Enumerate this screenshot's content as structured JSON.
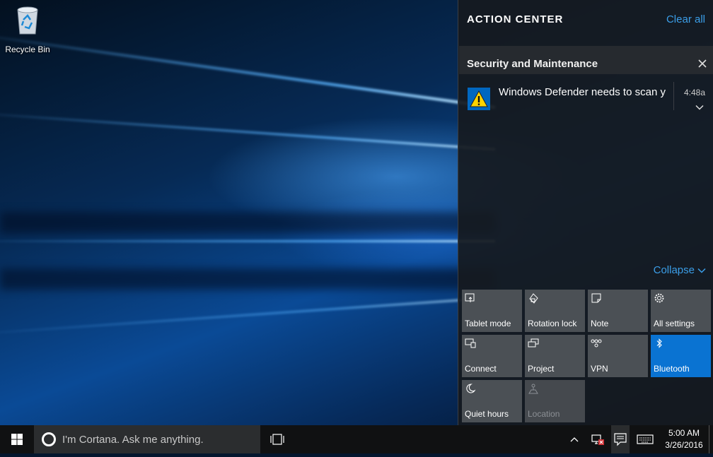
{
  "desktop": {
    "icons": [
      {
        "label": "Recycle Bin",
        "icon": "recycle-bin-icon"
      }
    ]
  },
  "action_center": {
    "title": "ACTION CENTER",
    "clear_all": "Clear all",
    "groups": [
      {
        "name": "Security and Maintenance",
        "notifications": [
          {
            "icon": "warning-icon",
            "text": "Windows Defender needs to scan your",
            "time": "4:48a"
          }
        ]
      }
    ],
    "collapse_label": "Collapse",
    "quick_actions": [
      {
        "label": "Tablet mode",
        "icon": "tablet-mode-icon",
        "state": "off"
      },
      {
        "label": "Rotation lock",
        "icon": "rotation-lock-icon",
        "state": "off"
      },
      {
        "label": "Note",
        "icon": "note-icon",
        "state": "off"
      },
      {
        "label": "All settings",
        "icon": "gear-icon",
        "state": "off"
      },
      {
        "label": "Connect",
        "icon": "connect-icon",
        "state": "off"
      },
      {
        "label": "Project",
        "icon": "project-icon",
        "state": "off"
      },
      {
        "label": "VPN",
        "icon": "vpn-icon",
        "state": "off"
      },
      {
        "label": "Bluetooth",
        "icon": "bluetooth-icon",
        "state": "on"
      },
      {
        "label": "Quiet hours",
        "icon": "moon-icon",
        "state": "off"
      },
      {
        "label": "Location",
        "icon": "location-icon",
        "state": "disabled"
      }
    ]
  },
  "taskbar": {
    "search_placeholder": "I'm Cortana. Ask me anything.",
    "clock_time": "5:00 AM",
    "clock_date": "3/26/2016"
  },
  "colors": {
    "accent": "#0a73d2",
    "link": "#3b9ee8",
    "tile": "#4b5055",
    "panel": "#16191f"
  }
}
